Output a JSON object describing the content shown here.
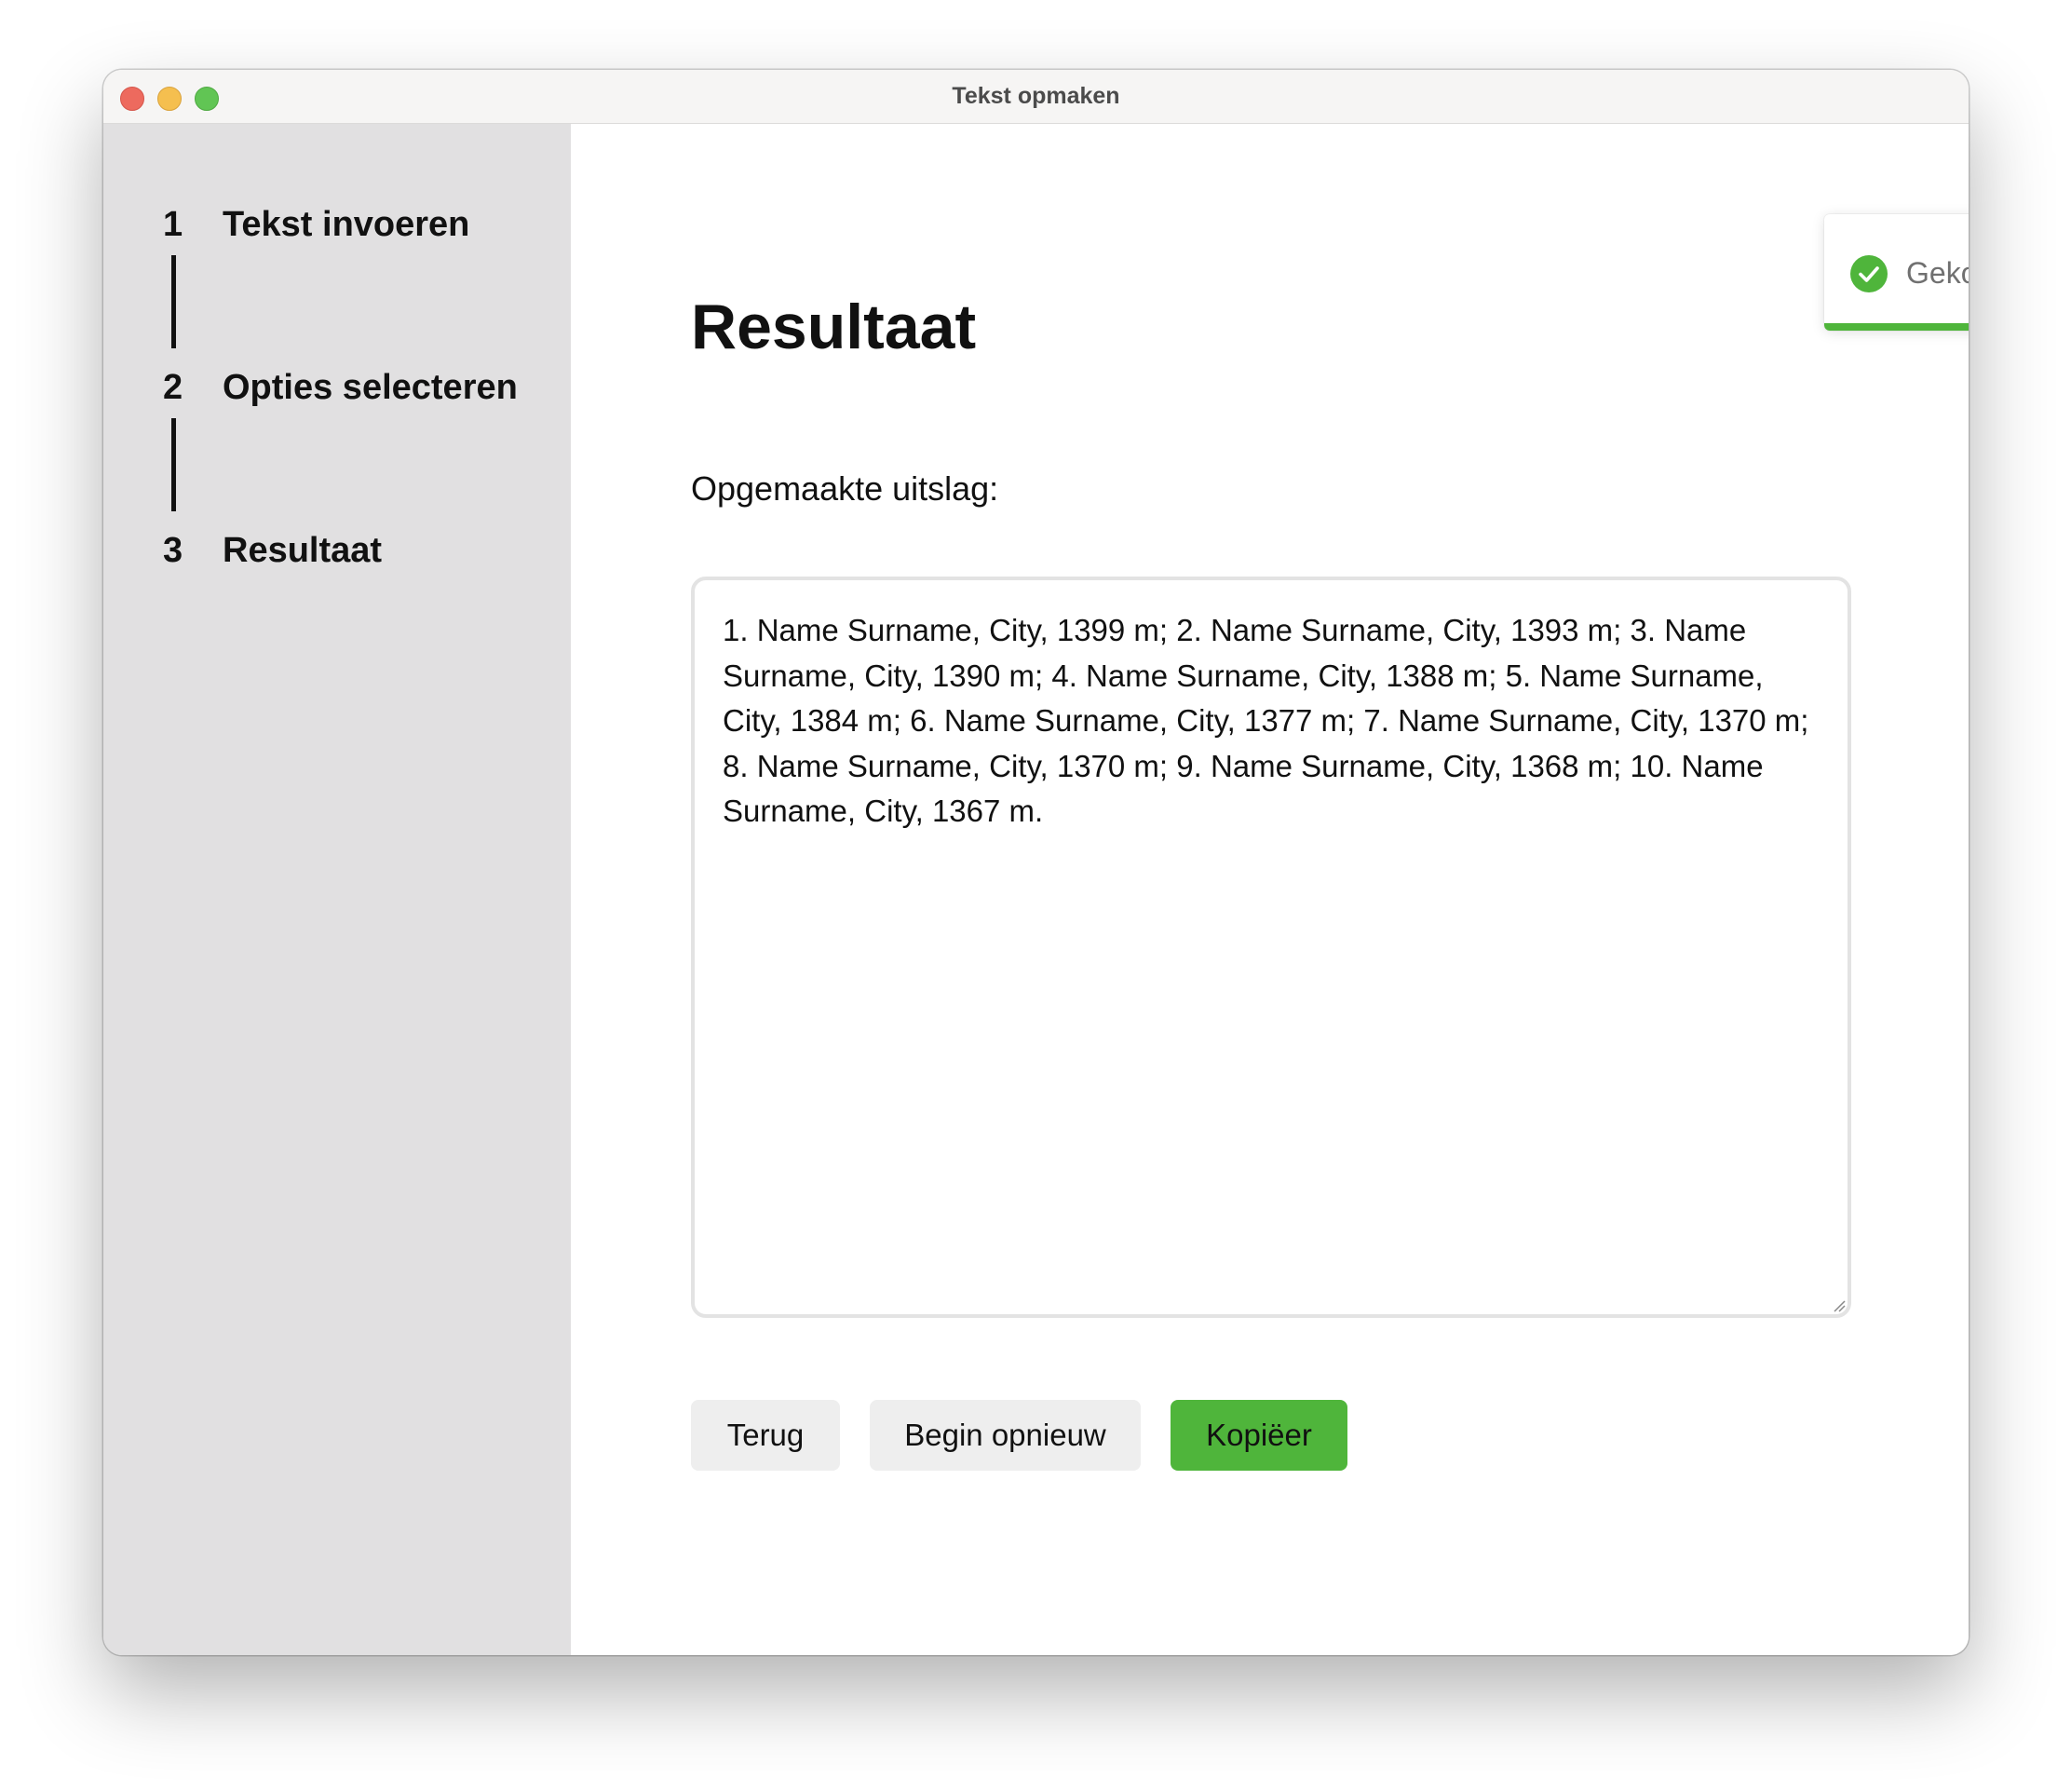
{
  "window": {
    "title": "Tekst opmaken"
  },
  "sidebar": {
    "steps": [
      {
        "number": "1",
        "label": "Tekst invoeren"
      },
      {
        "number": "2",
        "label": "Opties selecteren"
      },
      {
        "number": "3",
        "label": "Resultaat"
      }
    ],
    "active_step": 3
  },
  "main": {
    "title": "Resultaat",
    "output_label": "Opgemaakte uitslag:",
    "output_text": "1. Name Surname, City, 1399 m; 2. Name Surname, City, 1393 m; 3. Name Surname, City, 1390 m; 4. Name Surname, City, 1388 m; 5. Name Surname, City, 1384 m; 6. Name Surname, City, 1377 m; 7. Name Surname, City, 1370 m; 8. Name Surname, City, 1370 m; 9. Name Surname, City, 1368 m; 10. Name Surname, City, 1367 m."
  },
  "buttons": {
    "back_label": "Terug",
    "restart_label": "Begin opnieuw",
    "copy_label": "Kopiëer"
  },
  "toast": {
    "message": "Gekopiëerd",
    "progress_fraction": 0.76,
    "icon": "check-circle-icon",
    "close_icon": "close-icon"
  },
  "colors": {
    "accent_green": "#4fb53b",
    "sidebar_bg": "#e1e0e1",
    "traffic_close": "#ed6a5e",
    "traffic_minimize": "#f5bf4f",
    "traffic_zoom": "#61c554"
  }
}
